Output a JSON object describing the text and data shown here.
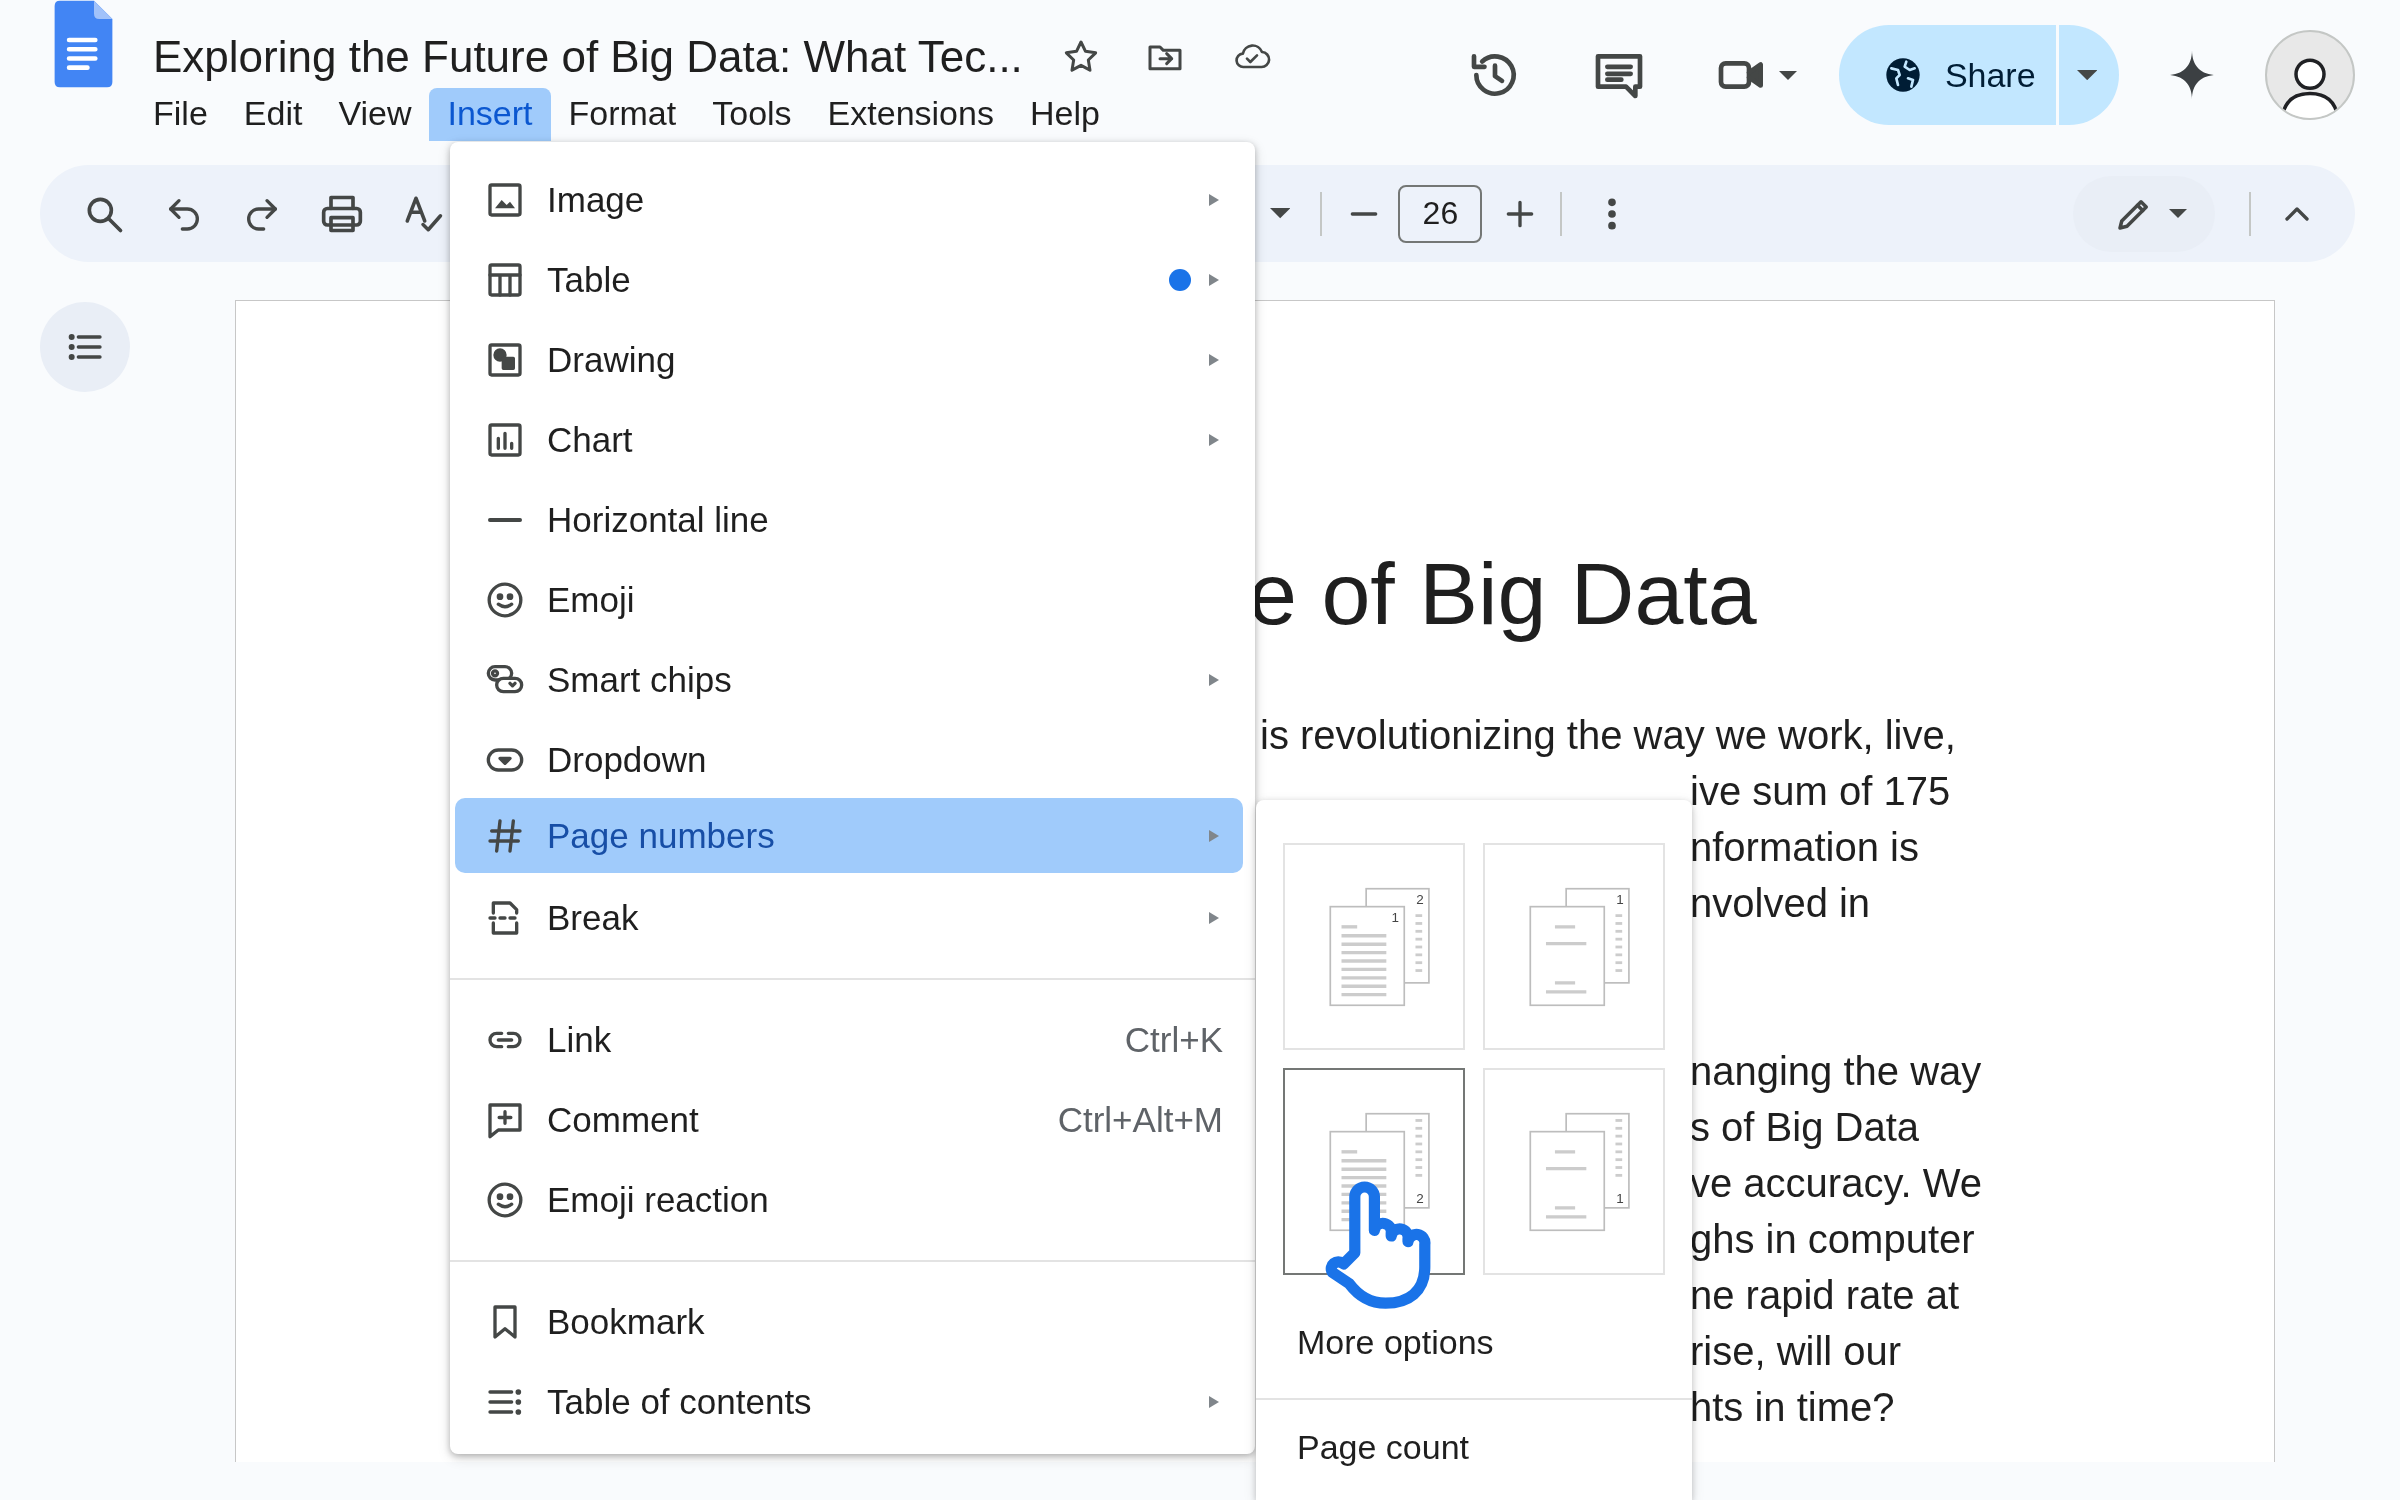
{
  "header": {
    "title": "Exploring the Future of Big Data: What Tec...",
    "menus": [
      {
        "label": "File",
        "selected": false
      },
      {
        "label": "Edit",
        "selected": false
      },
      {
        "label": "View",
        "selected": false
      },
      {
        "label": "Insert",
        "selected": true
      },
      {
        "label": "Format",
        "selected": false
      },
      {
        "label": "Tools",
        "selected": false
      },
      {
        "label": "Extensions",
        "selected": false
      },
      {
        "label": "Help",
        "selected": false
      }
    ],
    "share": {
      "label": "Share"
    }
  },
  "toolbar": {
    "font_size": "26"
  },
  "document": {
    "heading": "e of Big Data",
    "paragraphs": [
      [
        "is revolutionizing the way we work, live,",
        "ive sum of 175",
        "nformation is",
        "nvolved in"
      ],
      [
        "nanging the way",
        "s of Big Data",
        "ve accuracy. We",
        "ghs in computer",
        "ne rapid rate at",
        "rise, will our",
        "hts in time?"
      ]
    ]
  },
  "insert_menu": {
    "sections": [
      [
        {
          "kind": "image",
          "label": "Image",
          "has_submenu": true,
          "new": false,
          "selected": false
        },
        {
          "kind": "table",
          "label": "Table",
          "has_submenu": true,
          "new": true,
          "selected": false
        },
        {
          "kind": "drawing",
          "label": "Drawing",
          "has_submenu": true,
          "new": false,
          "selected": false
        },
        {
          "kind": "chart",
          "label": "Chart",
          "has_submenu": true,
          "new": false,
          "selected": false
        },
        {
          "kind": "hline",
          "label": "Horizontal line",
          "has_submenu": false,
          "new": false,
          "selected": false
        },
        {
          "kind": "emoji",
          "label": "Emoji",
          "has_submenu": false,
          "new": false,
          "selected": false
        },
        {
          "kind": "chips",
          "label": "Smart chips",
          "has_submenu": true,
          "new": false,
          "selected": false
        },
        {
          "kind": "dropdown",
          "label": "Dropdown",
          "has_submenu": false,
          "new": false,
          "selected": false
        },
        {
          "kind": "hash",
          "label": "Page numbers",
          "has_submenu": true,
          "new": false,
          "selected": true
        },
        {
          "kind": "break",
          "label": "Break",
          "has_submenu": true,
          "new": false,
          "selected": false
        }
      ],
      [
        {
          "kind": "link",
          "label": "Link",
          "shortcut": "Ctrl+K",
          "has_submenu": false,
          "new": false,
          "selected": false
        },
        {
          "kind": "comment",
          "label": "Comment",
          "shortcut": "Ctrl+Alt+M",
          "has_submenu": false,
          "new": false,
          "selected": false
        },
        {
          "kind": "emoji",
          "label": "Emoji reaction",
          "has_submenu": false,
          "new": false,
          "selected": false
        }
      ],
      [
        {
          "kind": "bookmark",
          "label": "Bookmark",
          "has_submenu": false,
          "new": false,
          "selected": false
        },
        {
          "kind": "toc",
          "label": "Table of contents",
          "has_submenu": true,
          "new": false,
          "selected": false
        }
      ]
    ]
  },
  "page_numbers_menu": {
    "options": [
      {
        "kind": "header",
        "cover_page": false,
        "front_number": "1",
        "back_number": "2",
        "selected": false
      },
      {
        "kind": "header",
        "cover_page": true,
        "back_number": "1",
        "selected": false
      },
      {
        "kind": "footer",
        "cover_page": false,
        "back_number": "2",
        "selected": true
      },
      {
        "kind": "footer",
        "cover_page": true,
        "back_number": "1",
        "selected": false
      }
    ],
    "more_options": "More options",
    "page_count": "Page count"
  }
}
